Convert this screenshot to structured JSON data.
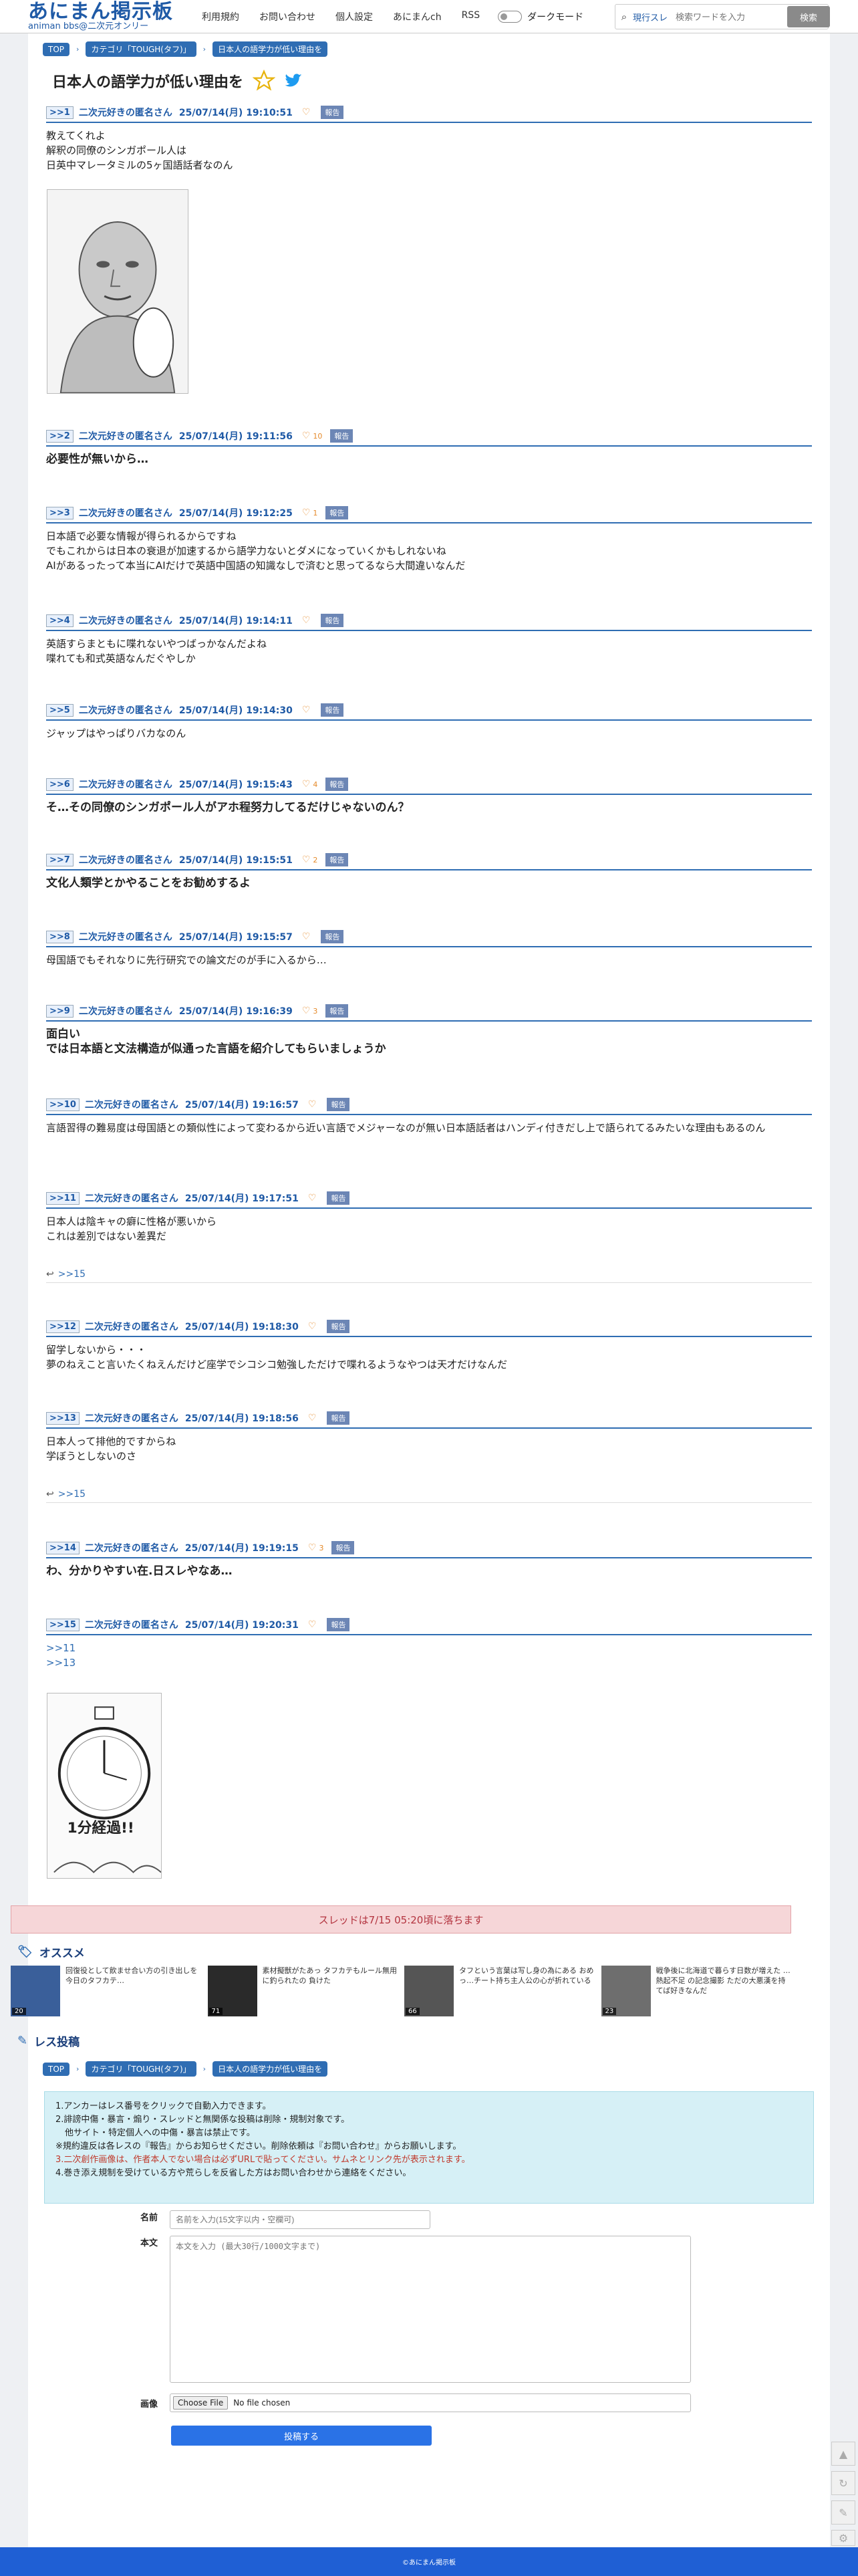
{
  "header": {
    "logo_main": "あにまん掲示板",
    "logo_sub": "animan bbs@二次元オンリー",
    "nav": [
      "利用規約",
      "お問い合わせ",
      "個人設定",
      "あにまんch",
      "RSS"
    ],
    "dark_mode_label": "ダークモード",
    "search_scope": "現行スレ",
    "search_placeholder": "検索ワードを入力",
    "search_button": "検索"
  },
  "breadcrumb": [
    "TOP",
    "カテゴリ「TOUGH(タフ)」",
    "日本人の語学力が低い理由を"
  ],
  "thread_title": "日本人の語学力が低い理由を",
  "report_label": "報告",
  "posts": [
    {
      "num": ">>1",
      "name": "二次元好きの匿名さん",
      "date": "25/07/14(月) 19:10:51",
      "hearts": "",
      "lines": [
        "教えてくれよ",
        "解釈の同僚のシンガポール人は",
        "日英中マレータミルの5ヶ国語話者なのん"
      ]
    },
    {
      "num": ">>2",
      "name": "二次元好きの匿名さん",
      "date": "25/07/14(月) 19:11:56",
      "hearts": "10",
      "lines": [
        "必要性が無いから…"
      ]
    },
    {
      "num": ">>3",
      "name": "二次元好きの匿名さん",
      "date": "25/07/14(月) 19:12:25",
      "hearts": "1",
      "lines": [
        "日本語で必要な情報が得られるからですね",
        "でもこれからは日本の衰退が加速するから語学力ないとダメになっていくかもしれないね",
        "AIがあるったって本当にAIだけで英語中国語の知識なしで済むと思ってるなら大間違いなんだ"
      ]
    },
    {
      "num": ">>4",
      "name": "二次元好きの匿名さん",
      "date": "25/07/14(月) 19:14:11",
      "hearts": "",
      "lines": [
        "英語すらまともに喋れないやつばっかなんだよね",
        "喋れても和式英語なんだぐやしか"
      ]
    },
    {
      "num": ">>5",
      "name": "二次元好きの匿名さん",
      "date": "25/07/14(月) 19:14:30",
      "hearts": "",
      "lines": [
        "ジャップはやっぱりバカなのん"
      ]
    },
    {
      "num": ">>6",
      "name": "二次元好きの匿名さん",
      "date": "25/07/14(月) 19:15:43",
      "hearts": "4",
      "lines": [
        "そ…その同僚のシンガポール人がアホ程努力してるだけじゃないのん？"
      ]
    },
    {
      "num": ">>7",
      "name": "二次元好きの匿名さん",
      "date": "25/07/14(月) 19:15:51",
      "hearts": "2",
      "lines": [
        "文化人類学とかやることをお勧めするよ"
      ]
    },
    {
      "num": ">>8",
      "name": "二次元好きの匿名さん",
      "date": "25/07/14(月) 19:15:57",
      "hearts": "",
      "lines": [
        "母国語でもそれなりに先行研究での論文だのが手に入るから…"
      ]
    },
    {
      "num": ">>9",
      "name": "二次元好きの匿名さん",
      "date": "25/07/14(月) 19:16:39",
      "hearts": "3",
      "lines": [
        "面白い",
        "では日本語と文法構造が似通った言語を紹介してもらいましょうか"
      ]
    },
    {
      "num": ">>10",
      "name": "二次元好きの匿名さん",
      "date": "25/07/14(月) 19:16:57",
      "hearts": "",
      "lines": [
        "言語習得の難易度は母国語との類似性によって変わるから近い言語でメジャーなのが無い日本語話者はハンディ付きだし上で語られてるみたいな理由もあるのん"
      ]
    },
    {
      "num": ">>11",
      "name": "二次元好きの匿名さん",
      "date": "25/07/14(月) 19:17:51",
      "hearts": "",
      "lines": [
        "日本人は陰キャの癖に性格が悪いから",
        "これは差別ではない差異だ"
      ],
      "reply": ">>15"
    },
    {
      "num": ">>12",
      "name": "二次元好きの匿名さん",
      "date": "25/07/14(月) 19:18:30",
      "hearts": "",
      "lines": [
        "留学しないから・・・",
        "夢のねえこと言いたくねえんだけど座学でシコシコ勉強しただけで喋れるようなやつは天才だけなんだ"
      ]
    },
    {
      "num": ">>13",
      "name": "二次元好きの匿名さん",
      "date": "25/07/14(月) 19:18:56",
      "hearts": "",
      "lines": [
        "日本人って排他的ですからね",
        "学ぼうとしないのさ"
      ],
      "reply": ">>15"
    },
    {
      "num": ">>14",
      "name": "二次元好きの匿名さん",
      "date": "25/07/14(月) 19:19:15",
      "hearts": "3",
      "lines": [
        "わ、分かりやすい在.日スレやなあ…"
      ]
    },
    {
      "num": ">>15",
      "name": "二次元好きの匿名さん",
      "date": "25/07/14(月) 19:20:31",
      "hearts": "",
      "lines": [
        ">>11",
        ">>13"
      ]
    }
  ],
  "image2_text": "1分経過!!",
  "notice": "スレッドは7/15 05:20頃に落ちます",
  "recommend_title": "オススメ",
  "recommend": [
    {
      "count": "20",
      "text": "回復役として飲ませ合い方の引き出しを 今日のタフカテ…"
    },
    {
      "count": "71",
      "text": "素材擬獣がたあっ タフカテもルール無用に釣られたの 負けた"
    },
    {
      "count": "66",
      "text": "タフという言葉は写し身の為にある おめっ…チート持ち主人公の心が折れている"
    },
    {
      "count": "23",
      "text": "戦争後に北海道で暮らす日数が増えた …熱起不足 の記念撮影 ただの大悪漢を持てば好きなんだ"
    }
  ],
  "post_form_title": "レス投稿",
  "rules": [
    "1.アンカーはレス番号をクリックで自動入力できます。",
    "2.誹謗中傷・暴言・煽り・スレッドと無関係な投稿は削除・規制対象です。",
    "他サイト・特定個人への中傷・暴言は禁止です。",
    "※規約違反は各レスの『報告』からお知らせください。削除依頼は『お問い合わせ』からお願いします。",
    "3.二次創作画像は、作者本人でない場合は必ずURLで貼ってください。サムネとリンク先が表示されます。",
    "4.巻き添え規制を受けている方や荒らしを反省した方はお問い合わせから連絡をください。"
  ],
  "form": {
    "name_label": "名前",
    "name_placeholder": "名前を入力(15文字以内・空欄可)",
    "body_label": "本文",
    "body_placeholder": "本文を入力 (最大30行/1000文字まで)",
    "image_label": "画像",
    "file_button": "Choose File",
    "file_status": "No file chosen",
    "submit": "投稿する"
  },
  "footer": "©あにまん掲示板",
  "colors": {
    "accent": "#2f6db3",
    "footer": "#1f5fd4",
    "notice_bg": "#f6d6d8"
  }
}
